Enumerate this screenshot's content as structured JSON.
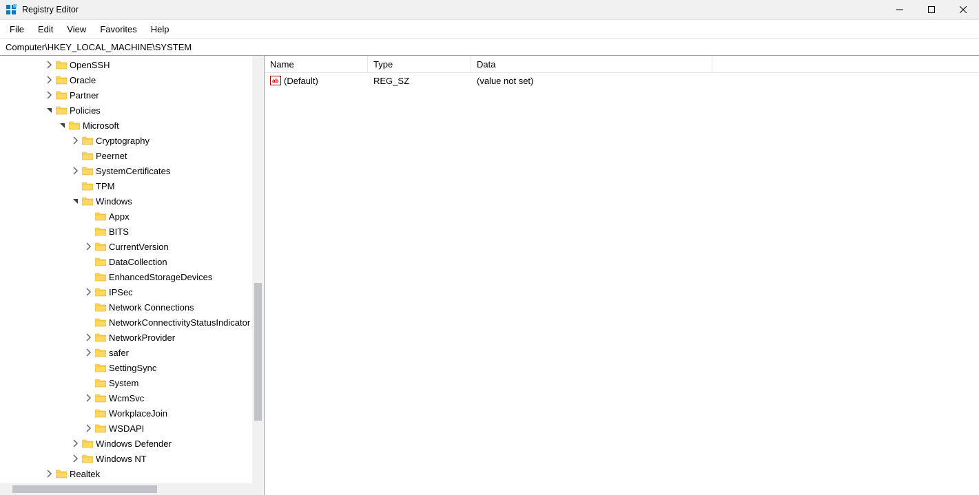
{
  "app": {
    "title": "Registry Editor"
  },
  "window_controls": {
    "minimize": "Minimize",
    "maximize": "Maximize",
    "close": "Close"
  },
  "menu": {
    "file": "File",
    "edit": "Edit",
    "view": "View",
    "favorites": "Favorites",
    "help": "Help"
  },
  "address": {
    "path": "Computer\\HKEY_LOCAL_MACHINE\\SYSTEM"
  },
  "tree": {
    "rows": [
      {
        "depth": 3,
        "expander": "closed",
        "label": "OpenSSH"
      },
      {
        "depth": 3,
        "expander": "closed",
        "label": "Oracle"
      },
      {
        "depth": 3,
        "expander": "closed",
        "label": "Partner"
      },
      {
        "depth": 3,
        "expander": "open",
        "label": "Policies"
      },
      {
        "depth": 4,
        "expander": "open",
        "label": "Microsoft"
      },
      {
        "depth": 5,
        "expander": "closed",
        "label": "Cryptography"
      },
      {
        "depth": 5,
        "expander": "none",
        "label": "Peernet"
      },
      {
        "depth": 5,
        "expander": "closed",
        "label": "SystemCertificates"
      },
      {
        "depth": 5,
        "expander": "none",
        "label": "TPM"
      },
      {
        "depth": 5,
        "expander": "open",
        "label": "Windows"
      },
      {
        "depth": 6,
        "expander": "none",
        "label": "Appx"
      },
      {
        "depth": 6,
        "expander": "none",
        "label": "BITS"
      },
      {
        "depth": 6,
        "expander": "closed",
        "label": "CurrentVersion"
      },
      {
        "depth": 6,
        "expander": "none",
        "label": "DataCollection"
      },
      {
        "depth": 6,
        "expander": "none",
        "label": "EnhancedStorageDevices"
      },
      {
        "depth": 6,
        "expander": "closed",
        "label": "IPSec"
      },
      {
        "depth": 6,
        "expander": "none",
        "label": "Network Connections"
      },
      {
        "depth": 6,
        "expander": "none",
        "label": "NetworkConnectivityStatusIndicator"
      },
      {
        "depth": 6,
        "expander": "closed",
        "label": "NetworkProvider"
      },
      {
        "depth": 6,
        "expander": "closed",
        "label": "safer"
      },
      {
        "depth": 6,
        "expander": "none",
        "label": "SettingSync"
      },
      {
        "depth": 6,
        "expander": "none",
        "label": "System"
      },
      {
        "depth": 6,
        "expander": "closed",
        "label": "WcmSvc"
      },
      {
        "depth": 6,
        "expander": "none",
        "label": "WorkplaceJoin"
      },
      {
        "depth": 6,
        "expander": "closed",
        "label": "WSDAPI"
      },
      {
        "depth": 5,
        "expander": "closed",
        "label": "Windows Defender"
      },
      {
        "depth": 5,
        "expander": "closed",
        "label": "Windows NT"
      },
      {
        "depth": 3,
        "expander": "closed",
        "label": "Realtek"
      }
    ]
  },
  "list": {
    "headers": {
      "name": "Name",
      "type": "Type",
      "data": "Data"
    },
    "rows": [
      {
        "name": "(Default)",
        "type": "REG_SZ",
        "data": "(value not set)"
      }
    ]
  }
}
